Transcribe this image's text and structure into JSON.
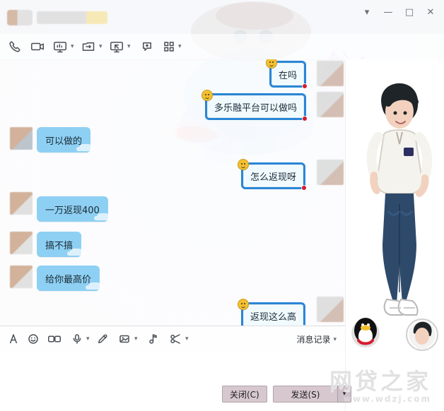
{
  "window": {
    "controls": {
      "chevron": "▾",
      "minimize": "—",
      "maximize": "□",
      "close": "✕"
    }
  },
  "toolbar": {
    "top_icons": [
      {
        "name": "call-icon"
      },
      {
        "name": "video-call-icon"
      },
      {
        "name": "screen-share-icon",
        "caret": "▾"
      },
      {
        "name": "file-transfer-icon",
        "caret": "▾"
      },
      {
        "name": "remote-assist-icon",
        "caret": "▾"
      },
      {
        "name": "whiteboard-icon"
      },
      {
        "name": "apps-icon",
        "caret": "▾"
      }
    ]
  },
  "messages": [
    {
      "from": "me",
      "text": "在吗"
    },
    {
      "from": "me",
      "text": "多乐融平台可以做吗"
    },
    {
      "from": "them",
      "text": "可以做的"
    },
    {
      "from": "me",
      "text": "怎么返现呀"
    },
    {
      "from": "them",
      "text": "一万返现400"
    },
    {
      "from": "them",
      "text": "搞不搞"
    },
    {
      "from": "them",
      "text": "给你最高价"
    },
    {
      "from": "me",
      "text": "返现这么高"
    }
  ],
  "composer": {
    "history_label": "消息记录",
    "history_caret": "▾",
    "buttons": {
      "close_label": "关闭(C)",
      "send_label": "发送(S)",
      "send_caret": "▾"
    }
  },
  "watermark": {
    "main": "网贷之家",
    "sub": "www.wdzj.com"
  }
}
